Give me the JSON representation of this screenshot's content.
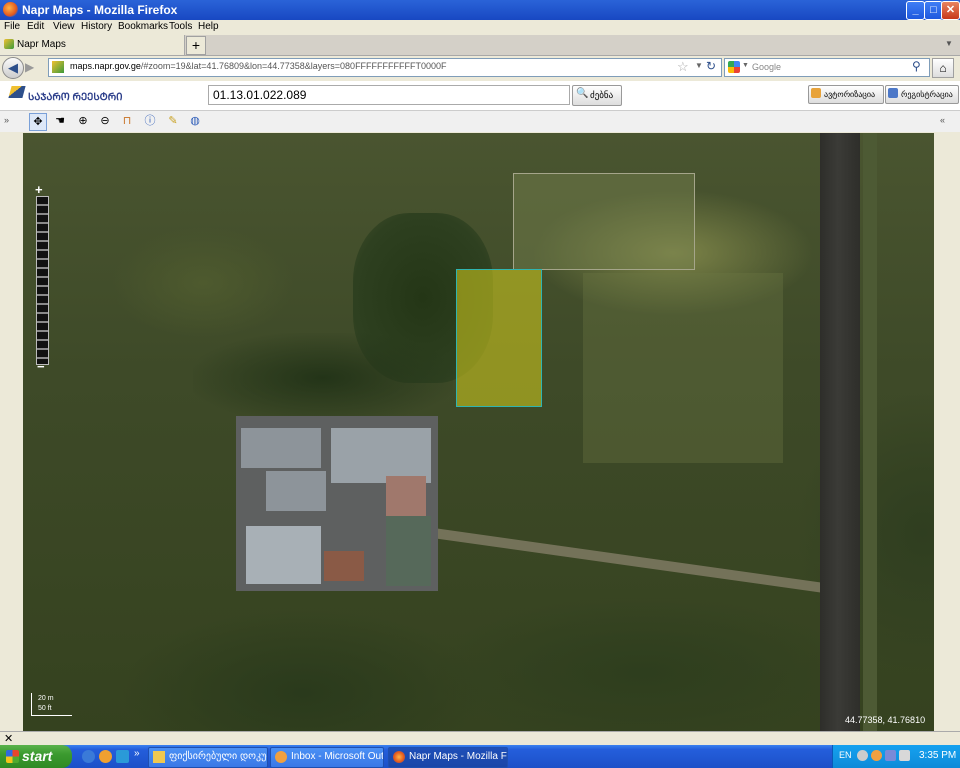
{
  "window": {
    "title": "Napr Maps - Mozilla Firefox",
    "controls": {
      "minimize": "_",
      "maximize": "□",
      "close": "✕"
    }
  },
  "menu": [
    "File",
    "Edit",
    "View",
    "History",
    "Bookmarks",
    "Tools",
    "Help"
  ],
  "tabs": [
    {
      "label": "Napr Maps",
      "active": true
    }
  ],
  "new_tab_label": "+",
  "nav": {
    "url_host": "maps.napr.gov.ge",
    "url_path": "/#zoom=19&lat=41.76809&lon=44.77358&layers=080FFFFFFFFFFFT0000F",
    "search_placeholder": "Google"
  },
  "app": {
    "logo_text": "ᲡᲐᲯᲐᲠᲝ ᲠᲔᲔᲡᲢᲠᲘ",
    "search_value": "01.13.01.022.089",
    "search_button": "ძებნა",
    "header_buttons": [
      "ავტორიზაცია",
      "რეგისტრაცია"
    ]
  },
  "map_tools": [
    "pan-icon",
    "hand-icon",
    "zoom-in-icon",
    "zoom-out-icon",
    "measure-icon",
    "info-icon",
    "edit-icon",
    "globe-icon"
  ],
  "map": {
    "zoom_plus": "+",
    "zoom_minus": "−",
    "scale_top": "20 m",
    "scale_bottom": "50 ft",
    "coordinates": "44.77358, 41.76810",
    "selection_color": "#d6d01e"
  },
  "taskbar": {
    "start_label": "start",
    "tasks": [
      {
        "label": "ფიქსირებული დოკუმენტები",
        "active": false
      },
      {
        "label": "Inbox - Microsoft Out...",
        "active": false
      },
      {
        "label": "Napr Maps - Mozilla Fi...",
        "active": true
      }
    ],
    "language": "EN",
    "clock": "3:35 PM"
  },
  "colors": {
    "titlebar": "#1f55cf",
    "taskbar": "#245edb",
    "start": "#3b9a2f"
  }
}
